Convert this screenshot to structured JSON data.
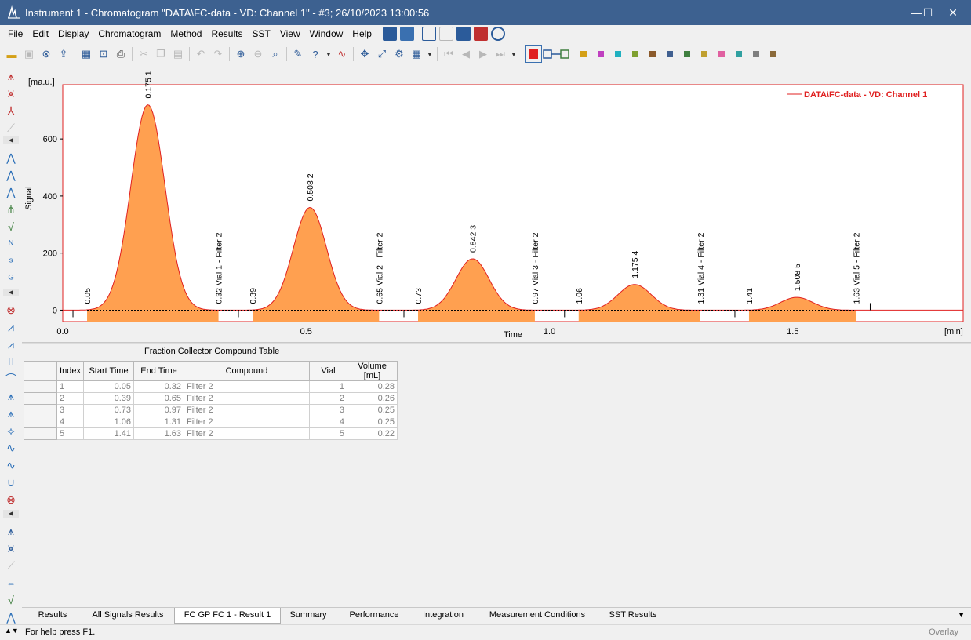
{
  "window": {
    "title": "Instrument 1 - Chromatogram \"DATA\\FC-data - VD: Channel 1\" - #3;   26/10/2023    13:00:56",
    "minimize": "—",
    "maximize": "☐",
    "close": "✕"
  },
  "menu": {
    "items": [
      "File",
      "Edit",
      "Display",
      "Chromatogram",
      "Method",
      "Results",
      "SST",
      "View",
      "Window",
      "Help"
    ]
  },
  "toolbar": {
    "swatch_colors": [
      "#d4a017",
      "#c040c0",
      "#20b0c0",
      "#7fa030",
      "#8b5a2b",
      "#406090",
      "#3f7f3f",
      "#c0a030",
      "#e060a0",
      "#30a0a0",
      "#7f7f7f",
      "#8b6a3a"
    ],
    "selected_color": "#e02020"
  },
  "chart": {
    "ylabel": "Signal",
    "yunit": "[ma.u.]",
    "xlabel": "Time",
    "xunit": "[min]",
    "legend": "DATA\\FC-data - VD: Channel 1",
    "series_color": "#e02020",
    "fill_color": "#ffa050",
    "x_ticks": [
      "0.0",
      "0.5",
      "1.0",
      "1.5"
    ],
    "y_ticks": [
      "0",
      "200",
      "400",
      "600"
    ]
  },
  "chart_data": {
    "type": "line",
    "xlim": [
      0,
      1.85
    ],
    "ylim": [
      -40,
      790
    ],
    "series": [
      {
        "name": "DATA\\FC-data - VD: Channel 1",
        "peaks": [
          {
            "rt": 0.175,
            "height": 720,
            "sigma": 0.035,
            "label": "0.175   1"
          },
          {
            "rt": 0.508,
            "height": 360,
            "sigma": 0.034,
            "label": "0.508   2"
          },
          {
            "rt": 0.842,
            "height": 180,
            "sigma": 0.034,
            "label": "0.842   3"
          },
          {
            "rt": 1.175,
            "height": 90,
            "sigma": 0.034,
            "label": "1.175   4"
          },
          {
            "rt": 1.508,
            "height": 45,
            "sigma": 0.033,
            "label": "1.508   5"
          }
        ]
      }
    ],
    "fractions": [
      {
        "start": 0.05,
        "end": 0.32,
        "start_label": "0.05",
        "end_label": "0.32 Vial 1 - Filter 2"
      },
      {
        "start": 0.39,
        "end": 0.65,
        "start_label": "0.39",
        "end_label": "0.65 Vial 2 - Filter 2"
      },
      {
        "start": 0.73,
        "end": 0.97,
        "start_label": "0.73",
        "end_label": "0.97 Vial 3 - Filter 2"
      },
      {
        "start": 1.06,
        "end": 1.31,
        "start_label": "1.06",
        "end_label": "1.31 Vial 4 - Filter 2"
      },
      {
        "start": 1.41,
        "end": 1.63,
        "start_label": "1.41",
        "end_label": "1.63 Vial 5 - Filter 2"
      }
    ]
  },
  "table": {
    "title": "Fraction Collector Compound Table",
    "headers": [
      "",
      "Index",
      "Start Time",
      "End Time",
      "Compound",
      "Vial",
      "Volume [mL]"
    ],
    "rows": [
      [
        "1",
        "0.05",
        "0.32",
        "Filter 2",
        "1",
        "0.28"
      ],
      [
        "2",
        "0.39",
        "0.65",
        "Filter 2",
        "2",
        "0.26"
      ],
      [
        "3",
        "0.73",
        "0.97",
        "Filter 2",
        "3",
        "0.25"
      ],
      [
        "4",
        "1.06",
        "1.31",
        "Filter 2",
        "4",
        "0.25"
      ],
      [
        "5",
        "1.41",
        "1.63",
        "Filter 2",
        "5",
        "0.22"
      ]
    ]
  },
  "tabs": {
    "items": [
      "Results",
      "All Signals Results",
      "FC GP FC 1 - Result 1",
      "Summary",
      "Performance",
      "Integration",
      "Measurement Conditions",
      "SST Results"
    ],
    "active": 2
  },
  "status": {
    "help": "For help press F1.",
    "mode": "Overlay"
  }
}
